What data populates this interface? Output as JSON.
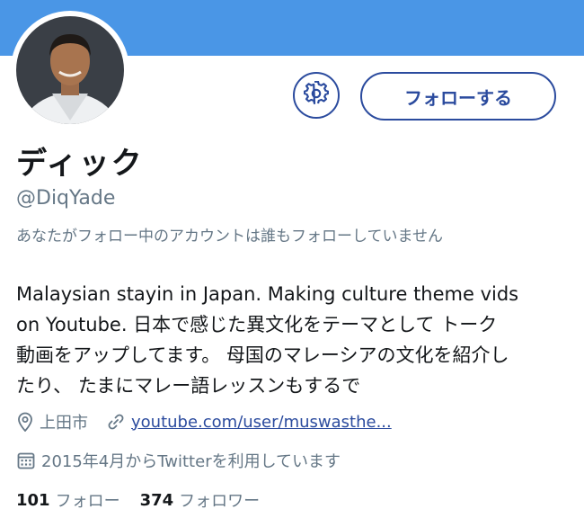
{
  "profile": {
    "display_name": "ディック",
    "handle": "@DiqYade",
    "followed_by_note": "あなたがフォロー中のアカウントは誰もフォローしていません",
    "bio_lines": [
      "Malaysian stayin in Japan. Making culture theme vids",
      "on Youtube. 日本で感じた異文化をテーマとして トーク",
      "動画をアップしてます。 母国のマレーシアの文化を紹介し",
      "たり、 たまにマレー語レッスンもするで"
    ],
    "location": "上田市",
    "website": "youtube.com/user/muswasthe...",
    "joined": "2015年4月からTwitterを利用しています"
  },
  "actions": {
    "follow_label": "フォローする",
    "settings_icon": "gear-icon"
  },
  "stats": {
    "following_count": "101",
    "following_label": "フォロー",
    "followers_count": "374",
    "followers_label": "フォロワー"
  },
  "colors": {
    "banner": "#4a96e6",
    "accent": "#2b4b9e",
    "secondary_text": "#657786"
  }
}
